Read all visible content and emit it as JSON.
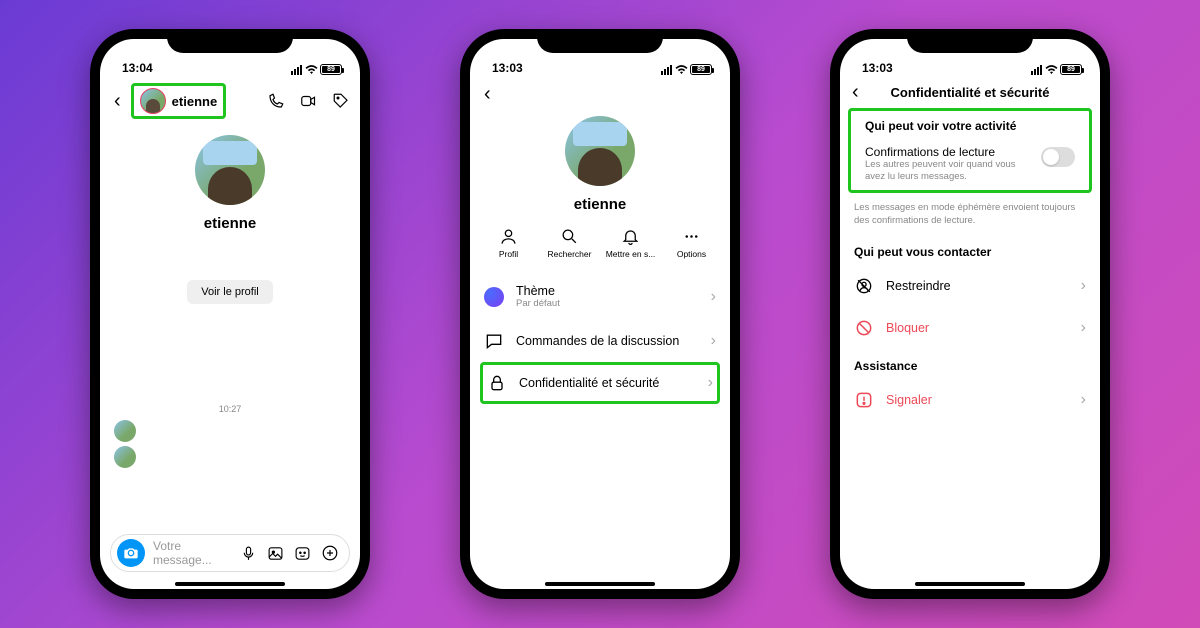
{
  "status": {
    "time1": "13:04",
    "time2": "13:03",
    "time3": "13:03",
    "battery": "89"
  },
  "phone1": {
    "username": "etienne",
    "profile_name": "etienne",
    "view_profile": "Voir le profil",
    "timestamp": "10:27",
    "composer_placeholder": "Votre message..."
  },
  "phone2": {
    "profile_name": "etienne",
    "actions": {
      "profile": "Profil",
      "search": "Rechercher",
      "mute": "Mettre en s...",
      "options": "Options"
    },
    "rows": {
      "theme": "Thème",
      "theme_sub": "Par défaut",
      "commands": "Commandes de la discussion",
      "privacy": "Confidentialité et sécurité"
    }
  },
  "phone3": {
    "title": "Confidentialité et sécurité",
    "section1": "Qui peut voir votre activité",
    "read_title": "Confirmations de lecture",
    "read_desc": "Les autres peuvent voir quand vous avez lu leurs messages.",
    "ephemeral_note": "Les messages en mode éphémère envoient toujours des confirmations de lecture.",
    "section2": "Qui peut vous contacter",
    "restrict": "Restreindre",
    "block": "Bloquer",
    "section3": "Assistance",
    "report": "Signaler"
  }
}
